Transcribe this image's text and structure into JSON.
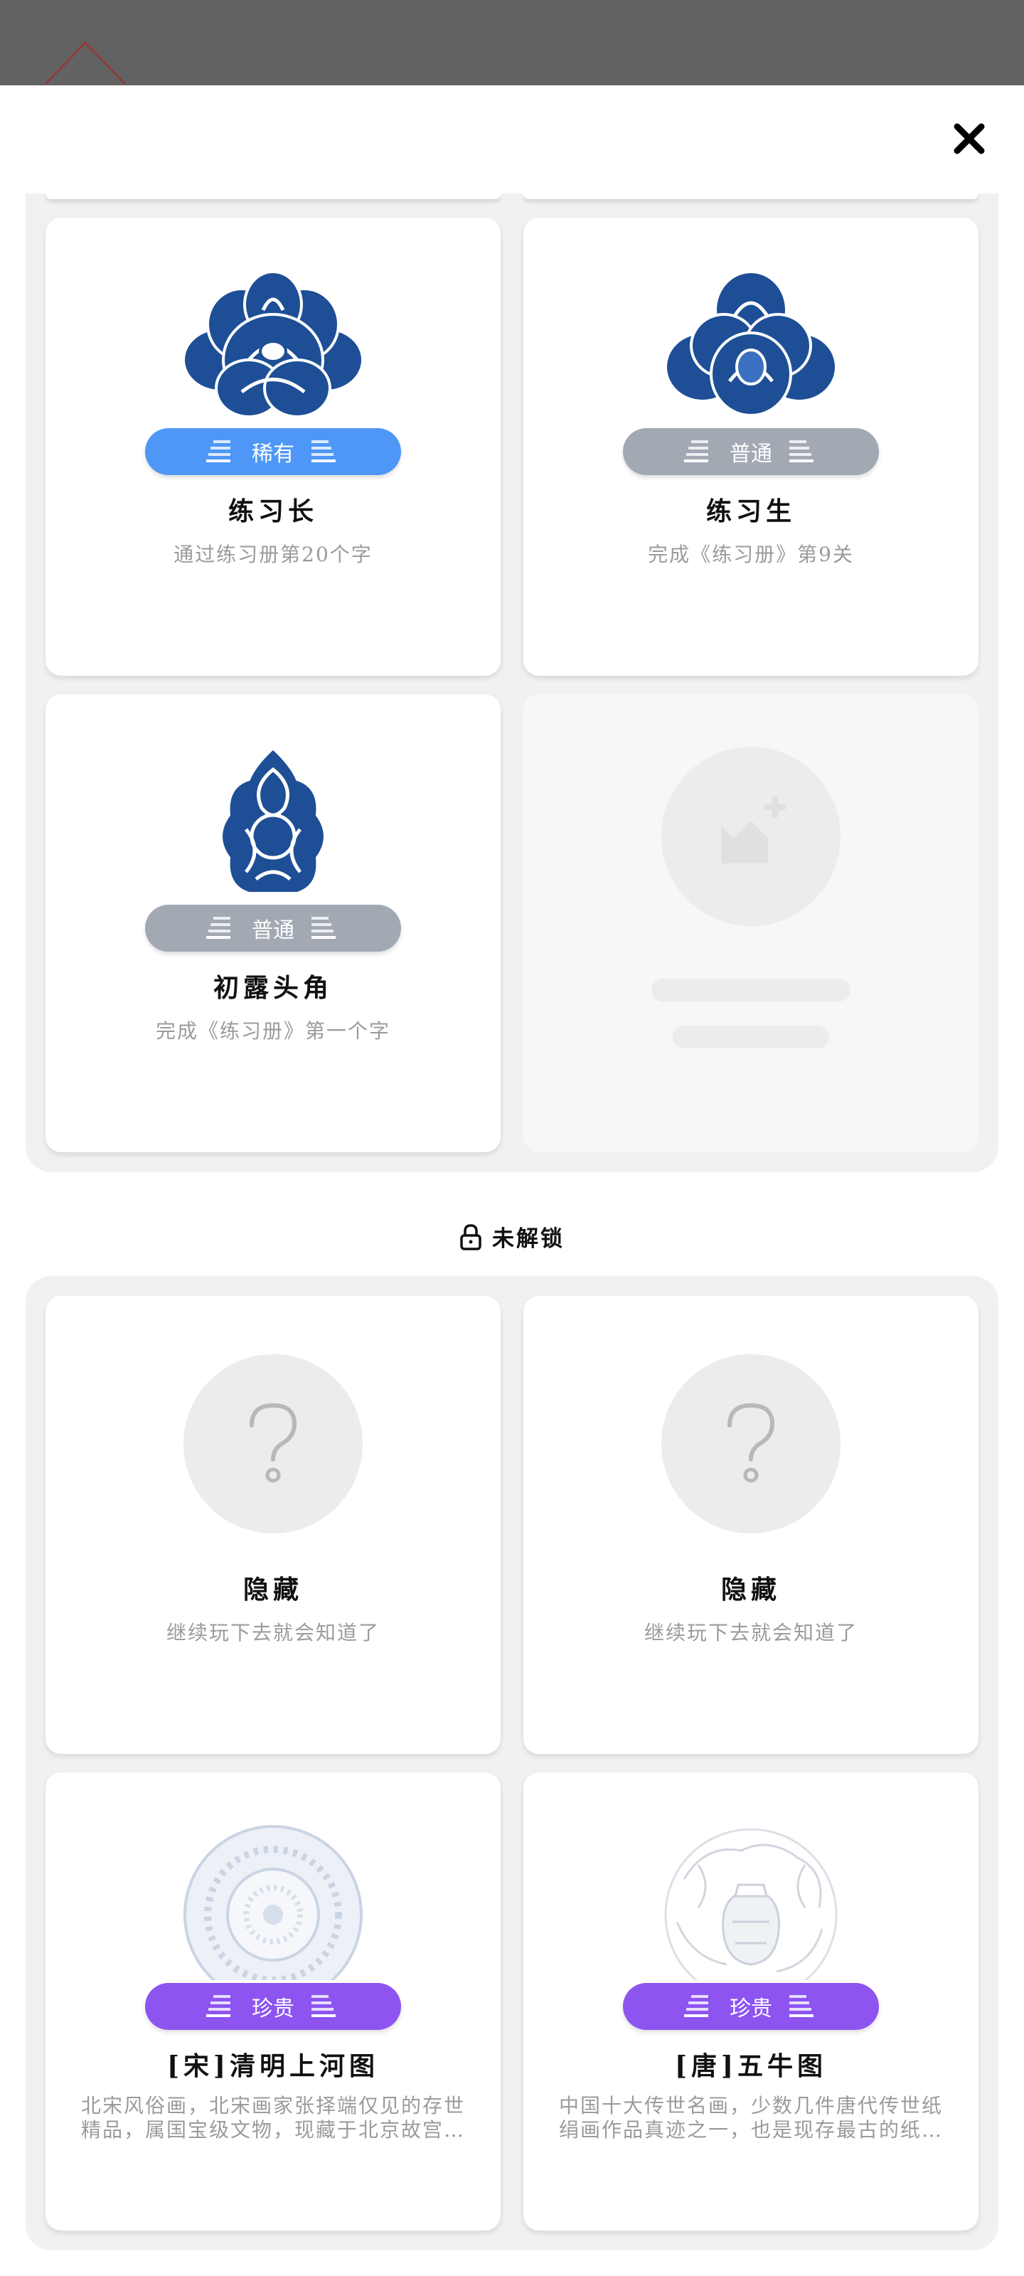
{
  "unlocked_cards": [
    {
      "title": "练习长",
      "description": "通过练习册第20个字",
      "rarity": "稀有",
      "icon": "peony-blossom-emblem"
    },
    {
      "title": "练习生",
      "description": "完成《练习册》第9关",
      "rarity": "普通",
      "icon": "lotus-blossom-emblem"
    },
    {
      "title": "初露头角",
      "description": "完成《练习册》第一个字",
      "rarity": "普通",
      "icon": "knot-pattern-emblem"
    }
  ],
  "locked_section": {
    "label": "未解锁",
    "icon": "lock-icon"
  },
  "locked_cards": [
    {
      "title": "隐藏",
      "description": "继续玩下去就会知道了",
      "icon": "question-mark-icon"
    },
    {
      "title": "隐藏",
      "description": "继续玩下去就会知道了",
      "icon": "question-mark-icon"
    },
    {
      "title": "[宋]清明上河图",
      "description": "北宋风俗画，北宋画家张择端仅见的存世精品，属国宝级文物，现藏于北京故宫博物院",
      "rarity": "珍贵",
      "icon": "porcelain-plate-emblem"
    },
    {
      "title": "[唐]五牛图",
      "description": "中国十大传世名画，少数几件唐代传世纸绢画作品真迹之一，也是现存最古的纸本中国画",
      "rarity": "珍贵",
      "icon": "dragon-vase-emblem"
    }
  ],
  "colors": {
    "rare": "#4e97f7",
    "common": "#a2a9b3",
    "precious": "#8d54f0",
    "emblem_blue": "#1e4f96"
  },
  "close_icon": "close-icon"
}
